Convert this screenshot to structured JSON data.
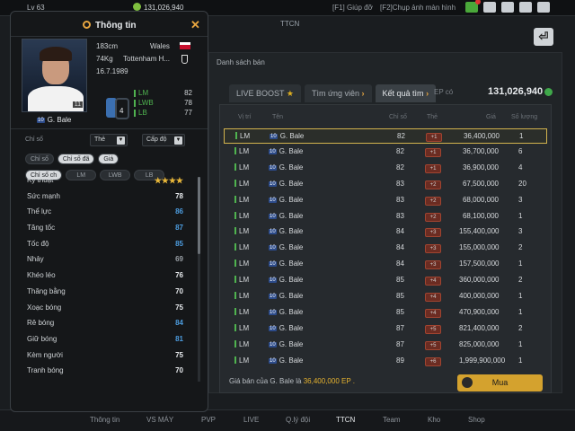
{
  "topbar": {
    "level_text": "Lv 63",
    "money": "131,026,940",
    "hotkey_help": "[F1] Giúp đỡ",
    "hotkey_screenshot": "[F2]Chụp ảnh màn hình"
  },
  "sub_label": "TTCN",
  "right_panel": {
    "section_label": "Danh sách bán",
    "tabs": [
      "LIVE BOOST",
      "Tìm ứng viên",
      "Kết quả tìm"
    ],
    "ep_label": "EP có",
    "ep_value": "131,026,940",
    "columns": [
      "Vị trí",
      "Tên",
      "Chỉ số",
      "Thẻ",
      "Giá",
      "Số lượng"
    ],
    "rows": [
      {
        "pos": "LM",
        "season": "10",
        "name": "G. Bale",
        "ovr": "82",
        "card": "+1",
        "price": "36,400,000",
        "qty": "1",
        "selected": true
      },
      {
        "pos": "LM",
        "season": "10",
        "name": "G. Bale",
        "ovr": "82",
        "card": "+1",
        "price": "36,700,000",
        "qty": "6",
        "selected": false
      },
      {
        "pos": "LM",
        "season": "10",
        "name": "G. Bale",
        "ovr": "82",
        "card": "+1",
        "price": "36,900,000",
        "qty": "4",
        "selected": false
      },
      {
        "pos": "LM",
        "season": "10",
        "name": "G. Bale",
        "ovr": "83",
        "card": "+2",
        "price": "67,500,000",
        "qty": "20",
        "selected": false
      },
      {
        "pos": "LM",
        "season": "10",
        "name": "G. Bale",
        "ovr": "83",
        "card": "+2",
        "price": "68,000,000",
        "qty": "3",
        "selected": false
      },
      {
        "pos": "LM",
        "season": "10",
        "name": "G. Bale",
        "ovr": "83",
        "card": "+2",
        "price": "68,100,000",
        "qty": "1",
        "selected": false
      },
      {
        "pos": "LM",
        "season": "10",
        "name": "G. Bale",
        "ovr": "84",
        "card": "+3",
        "price": "155,400,000",
        "qty": "3",
        "selected": false
      },
      {
        "pos": "LM",
        "season": "10",
        "name": "G. Bale",
        "ovr": "84",
        "card": "+3",
        "price": "155,000,000",
        "qty": "2",
        "selected": false
      },
      {
        "pos": "LM",
        "season": "10",
        "name": "G. Bale",
        "ovr": "84",
        "card": "+3",
        "price": "157,500,000",
        "qty": "1",
        "selected": false
      },
      {
        "pos": "LM",
        "season": "10",
        "name": "G. Bale",
        "ovr": "85",
        "card": "+4",
        "price": "360,000,000",
        "qty": "2",
        "selected": false
      },
      {
        "pos": "LM",
        "season": "10",
        "name": "G. Bale",
        "ovr": "85",
        "card": "+4",
        "price": "400,000,000",
        "qty": "1",
        "selected": false
      },
      {
        "pos": "LM",
        "season": "10",
        "name": "G. Bale",
        "ovr": "85",
        "card": "+4",
        "price": "470,900,000",
        "qty": "1",
        "selected": false
      },
      {
        "pos": "LM",
        "season": "10",
        "name": "G. Bale",
        "ovr": "87",
        "card": "+5",
        "price": "821,400,000",
        "qty": "2",
        "selected": false
      },
      {
        "pos": "LM",
        "season": "10",
        "name": "G. Bale",
        "ovr": "87",
        "card": "+5",
        "price": "825,000,000",
        "qty": "1",
        "selected": false
      },
      {
        "pos": "LM",
        "season": "10",
        "name": "G. Bale",
        "ovr": "89",
        "card": "+6",
        "price": "1,999,900,000",
        "qty": "1",
        "selected": false
      }
    ],
    "sell_price_prefix": "Giá bán của G. Bale là",
    "sell_price_value": "36,400,000 EP .",
    "buy_button": "Mua"
  },
  "bottom_nav": [
    "Thông tin",
    "VS MÁY",
    "PVP",
    "LIVE",
    "Q.lý đội",
    "TTCN",
    "Team",
    "Kho",
    "Shop"
  ],
  "info_panel": {
    "title": "Thông tin",
    "player_name": "G. Bale",
    "season_badge": "10",
    "height": "183cm",
    "weight": "74Kg",
    "birthdate": "16.7.1989",
    "nation": "Wales",
    "club": "Tottenham H...",
    "overall_badge": "4",
    "positions": [
      {
        "pos": "LM",
        "value": "82"
      },
      {
        "pos": "LWB",
        "value": "78"
      },
      {
        "pos": "LB",
        "value": "77"
      }
    ],
    "stat_label": "Chỉ số",
    "card_select": "Thẻ",
    "level_select": "Cấp độ",
    "subtabs": [
      "Chỉ số",
      "Chỉ số đã",
      "Giá"
    ],
    "position_tabs": [
      "Chỉ số ch",
      "LM",
      "LWB",
      "LB"
    ],
    "skill_label": "Kỹ thuật",
    "skill_stars": "★★★★",
    "stats": [
      {
        "name": "Sức mạnh",
        "value": "78",
        "tone": "white"
      },
      {
        "name": "Thể lực",
        "value": "86",
        "tone": "blue"
      },
      {
        "name": "Tăng tốc",
        "value": "87",
        "tone": "blue"
      },
      {
        "name": "Tốc độ",
        "value": "85",
        "tone": "blue"
      },
      {
        "name": "Nhảy",
        "value": "69",
        "tone": "gray"
      },
      {
        "name": "Khéo léo",
        "value": "76",
        "tone": "white"
      },
      {
        "name": "Thăng bằng",
        "value": "70",
        "tone": "white"
      },
      {
        "name": "Xoạc bóng",
        "value": "75",
        "tone": "white"
      },
      {
        "name": "Rê bóng",
        "value": "84",
        "tone": "blue"
      },
      {
        "name": "Giữ bóng",
        "value": "81",
        "tone": "blue"
      },
      {
        "name": "Kèm người",
        "value": "75",
        "tone": "white"
      },
      {
        "name": "Tranh bóng",
        "value": "70",
        "tone": "white"
      }
    ]
  },
  "colors": {
    "accent_gold": "#d4a22e",
    "stat_blue": "#4d9de0",
    "position_green": "#4fb34f"
  }
}
